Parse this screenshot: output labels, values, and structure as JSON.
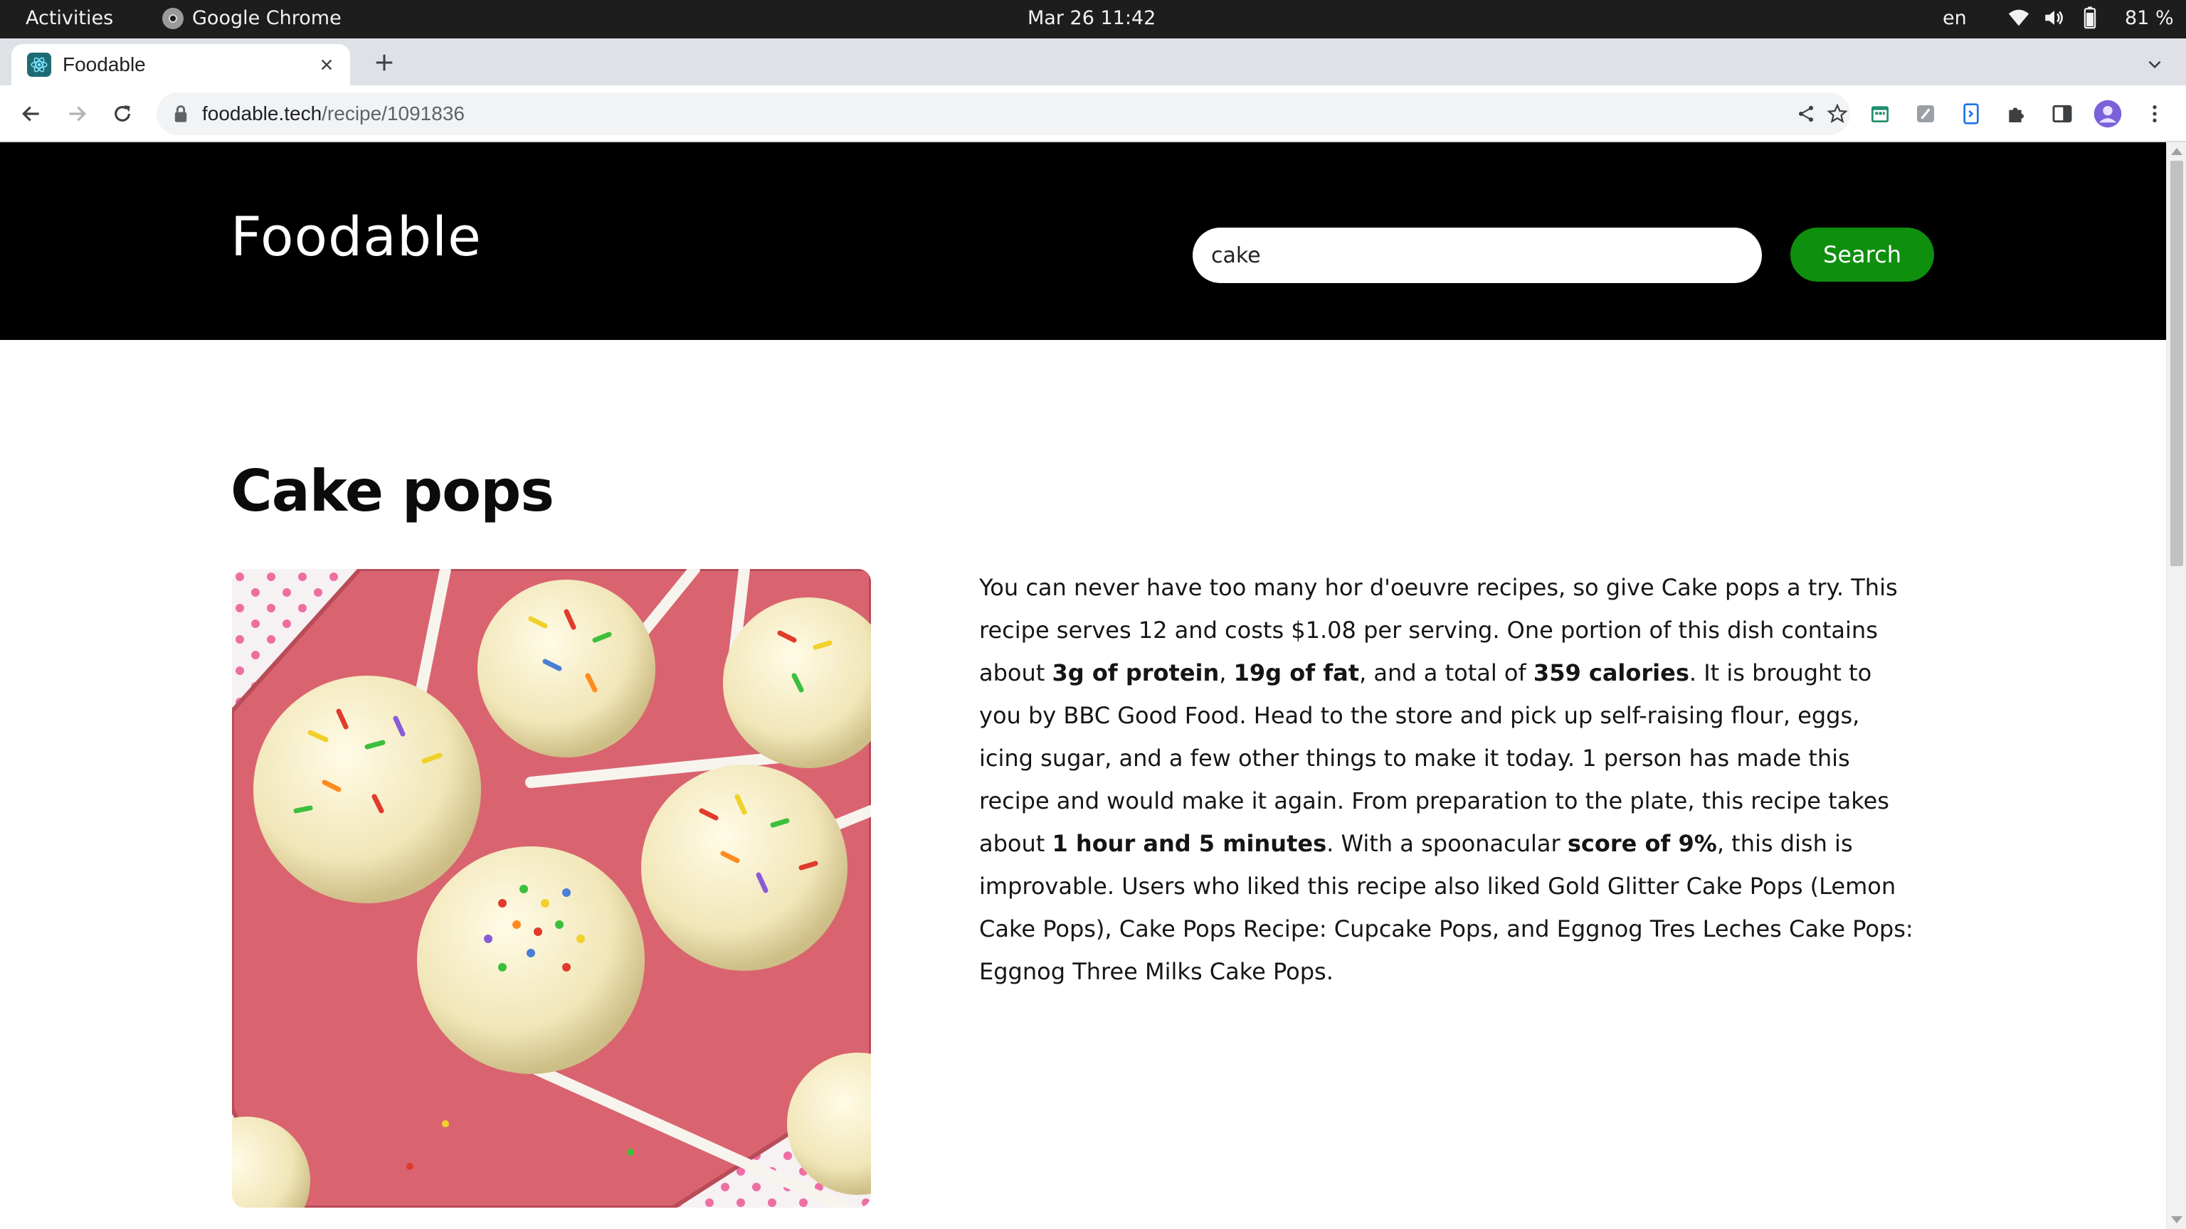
{
  "system_bar": {
    "activities": "Activities",
    "app_name": "Google Chrome",
    "clock": "Mar 26  11:42",
    "language": "en",
    "battery": "81 %"
  },
  "browser": {
    "tab_title": "Foodable",
    "url_domain": "foodable.tech",
    "url_path": "/recipe/1091836"
  },
  "site": {
    "logo": "Foodable",
    "search": {
      "value": "cake",
      "button_label": "Search"
    }
  },
  "recipe": {
    "title": "Cake pops",
    "image_alt": "Cake pops",
    "description": {
      "p1": "You can never have too many hor d'oeuvre recipes, so give Cake pops a try. This recipe serves 12 and costs $1.08 per serving. One portion of this dish contains about ",
      "protein": "3g of protein",
      "sep1": ", ",
      "fat": "19g of fat",
      "p2": ", and a total of ",
      "calories": "359 calories",
      "p3": ". It is brought to you by BBC Good Food. Head to the store and pick up self-raising flour, eggs, icing sugar, and a few other things to make it today. 1 person has made this recipe and would make it again. From preparation to the plate, this recipe takes about ",
      "time": "1 hour and 5 minutes",
      "p4": ". With a spoonacular ",
      "score": "score of 9%",
      "p5": ", this dish is improvable. Users who liked this recipe also liked Gold Glitter Cake Pops (Lemon Cake Pops), Cake Pops Recipe: Cupcake Pops, and Eggnog Tres Leches Cake Pops: Eggnog Three Milks Cake Pops."
    }
  },
  "colors": {
    "header_bg": "#000000",
    "search_button": "#0e8f0e",
    "page_bg": "#ffffff",
    "plate": "#d9646f"
  },
  "icons": {
    "back": "arrow-left-icon",
    "forward": "arrow-right-icon",
    "reload": "reload-icon",
    "lock": "lock-icon",
    "share": "share-icon",
    "bookmark": "star-icon",
    "extensions": "puzzle-icon",
    "menu": "kebab-menu-icon"
  }
}
